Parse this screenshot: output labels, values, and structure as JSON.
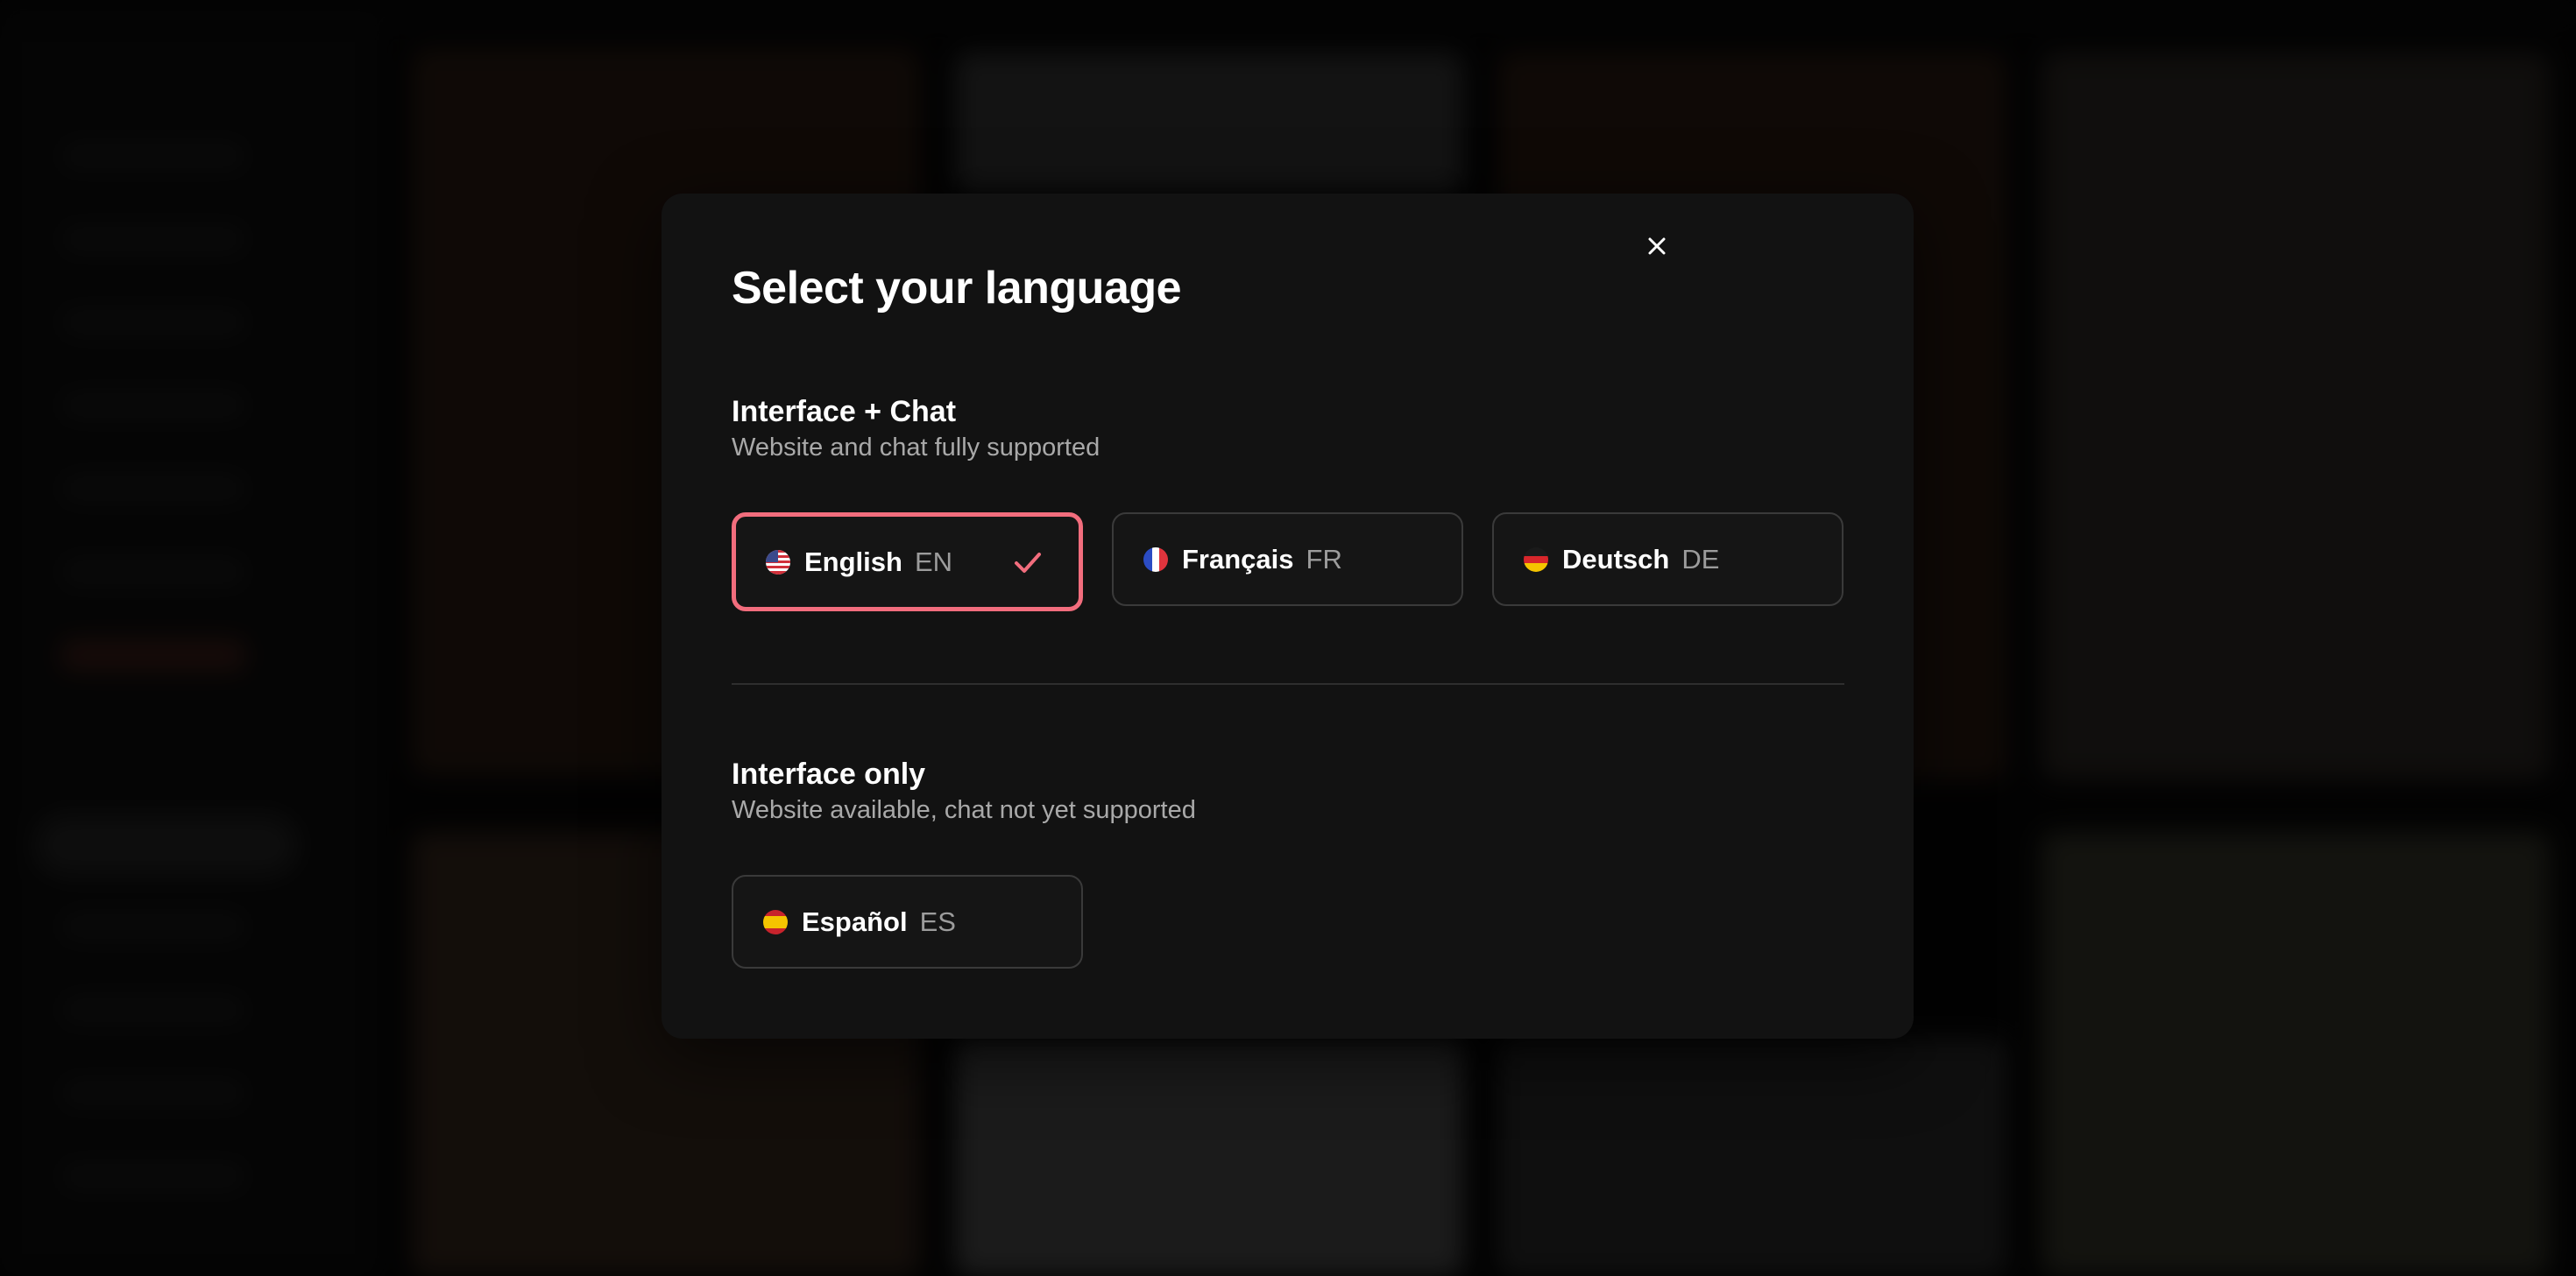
{
  "modal": {
    "title": "Select your language",
    "close_icon": "close-icon",
    "accent_color": "#f26d7d"
  },
  "sections": [
    {
      "title": "Interface + Chat",
      "subtitle": "Website and chat fully supported",
      "languages": [
        {
          "name": "English",
          "code": "EN",
          "flag": "us-flag-icon",
          "selected": true
        },
        {
          "name": "Français",
          "code": "FR",
          "flag": "fr-flag-icon",
          "selected": false
        },
        {
          "name": "Deutsch",
          "code": "DE",
          "flag": "de-flag-icon",
          "selected": false
        }
      ]
    },
    {
      "title": "Interface only",
      "subtitle": "Website available, chat not yet supported",
      "languages": [
        {
          "name": "Español",
          "code": "ES",
          "flag": "es-flag-icon",
          "selected": false
        }
      ]
    }
  ]
}
